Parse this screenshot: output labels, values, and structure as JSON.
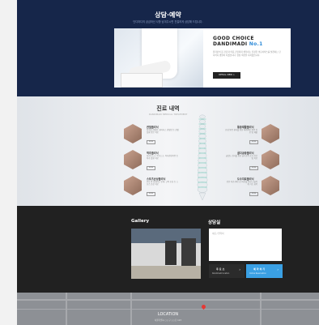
{
  "consult": {
    "title": "상담·예약",
    "subtitle": "단디마디의 궁금하신 사항 남겨주시면 친절하게 상담해 드립니다.",
    "card": {
      "line1": "GOOD CHOICE",
      "line2": "DANDIMADI",
      "line2_accent": "No.1",
      "desc": "환자분의 몸 건강과 마음 건강까지 생각하는 진정한 의료서비스를 실천하는 단디마디 병원이 되겠습니다. 항상 최선을 다하겠습니다.",
      "button": "DETAIL VIEW >"
    }
  },
  "treatment": {
    "title": "진료 내역",
    "subtitle": "DANDIMADI MEDICAL TREATMENT",
    "items": [
      {
        "title": "관절클리닉",
        "desc": "퇴행성 관절염, 류마티스 관절염 등 관절 질환 전문 치료",
        "more": "MORE"
      },
      {
        "title": "척추클리닉",
        "desc": "허리디스크, 목디스크, 척추관협착증 등 척추 질환 치료",
        "more": "MORE"
      },
      {
        "title": "스포츠손상클리닉",
        "desc": "운동 중 발생하는 인대, 근육 손상 등 스포츠 손상 치료",
        "more": "MORE"
      },
      {
        "title": "통증재활클리닉",
        "desc": "만성 통증 환자를 위한 체계적인 통증 치료 및 재활",
        "more": "MORE"
      },
      {
        "title": "골다공증클리닉",
        "desc": "골밀도 검사를 통한 골다공증 조기 진단 및 치료",
        "more": "MORE"
      },
      {
        "title": "도수치료클리닉",
        "desc": "전문 치료사의 도수치료를 통한 근골격계 기능 회복",
        "more": "MORE"
      }
    ]
  },
  "gallery": {
    "title": "Gallery"
  },
  "contact": {
    "title": "상담실",
    "placeholder": "이름 / 연락처",
    "btn1_label": "주 요 소",
    "btn1_sub": "Dandimadi location",
    "btn2_label": "예 약 하 기",
    "btn2_sub": "Online Reservation"
  },
  "location": {
    "title": "LOCATION",
    "address": "서울특별시 ○○구 ○○로 123"
  },
  "colors": {
    "navy": "#16264a",
    "accent": "#2e8bd8",
    "dark": "#212121",
    "blue_button": "#3aa0e4"
  }
}
